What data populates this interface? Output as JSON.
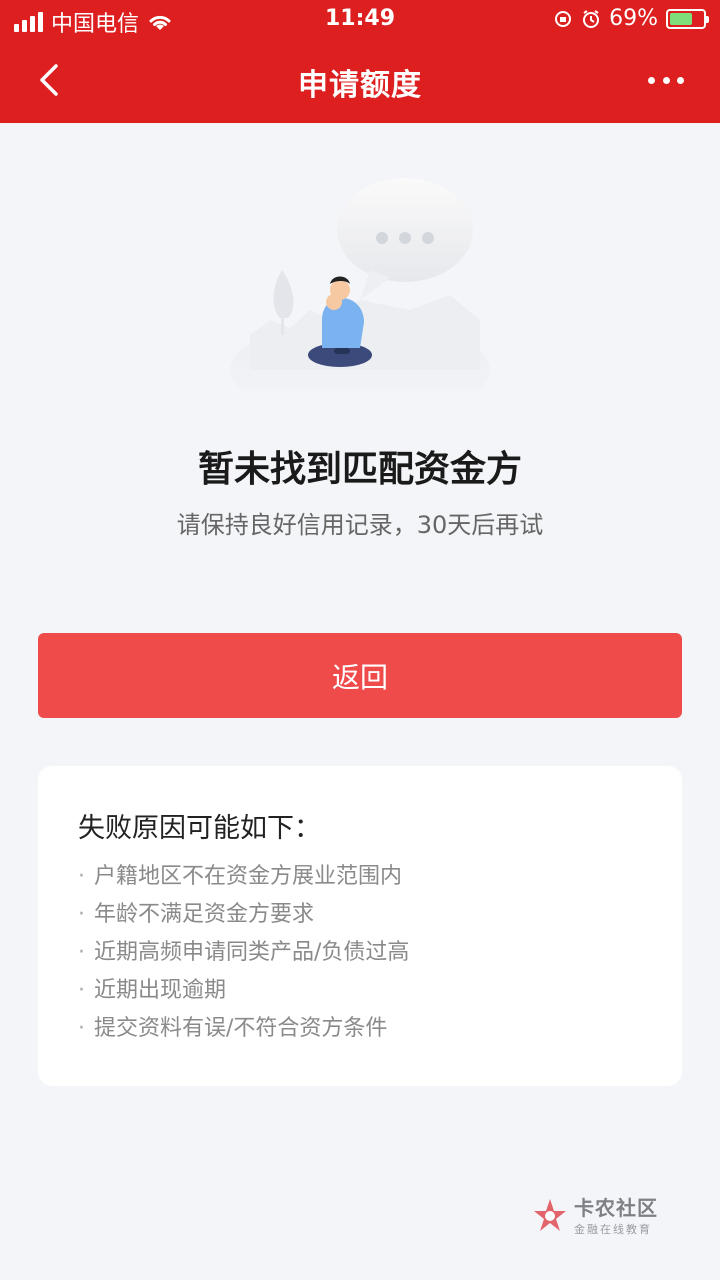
{
  "status_bar": {
    "carrier": "中国电信",
    "time": "11:49",
    "battery_percent_text": "69%",
    "battery_level": 0.69
  },
  "navbar": {
    "title": "申请额度"
  },
  "result": {
    "headline": "暂未找到匹配资金方",
    "subline": "请保持良好信用记录，30天后再试"
  },
  "actions": {
    "back_label": "返回"
  },
  "reasons_card": {
    "title": "失败原因可能如下：",
    "bullet": "·",
    "items": [
      "户籍地区不在资金方展业范围内",
      "年龄不满足资金方要求",
      "近期高频申请同类产品/负债过高",
      "近期出现逾期",
      "提交资料有误/不符合资方条件"
    ]
  },
  "watermark": {
    "name": "卡农社区",
    "tagline": "金融在线教育"
  },
  "colors": {
    "header": "#dd1f1f",
    "primary_button": "#ef4b4b",
    "page_background": "#f4f5f9"
  }
}
